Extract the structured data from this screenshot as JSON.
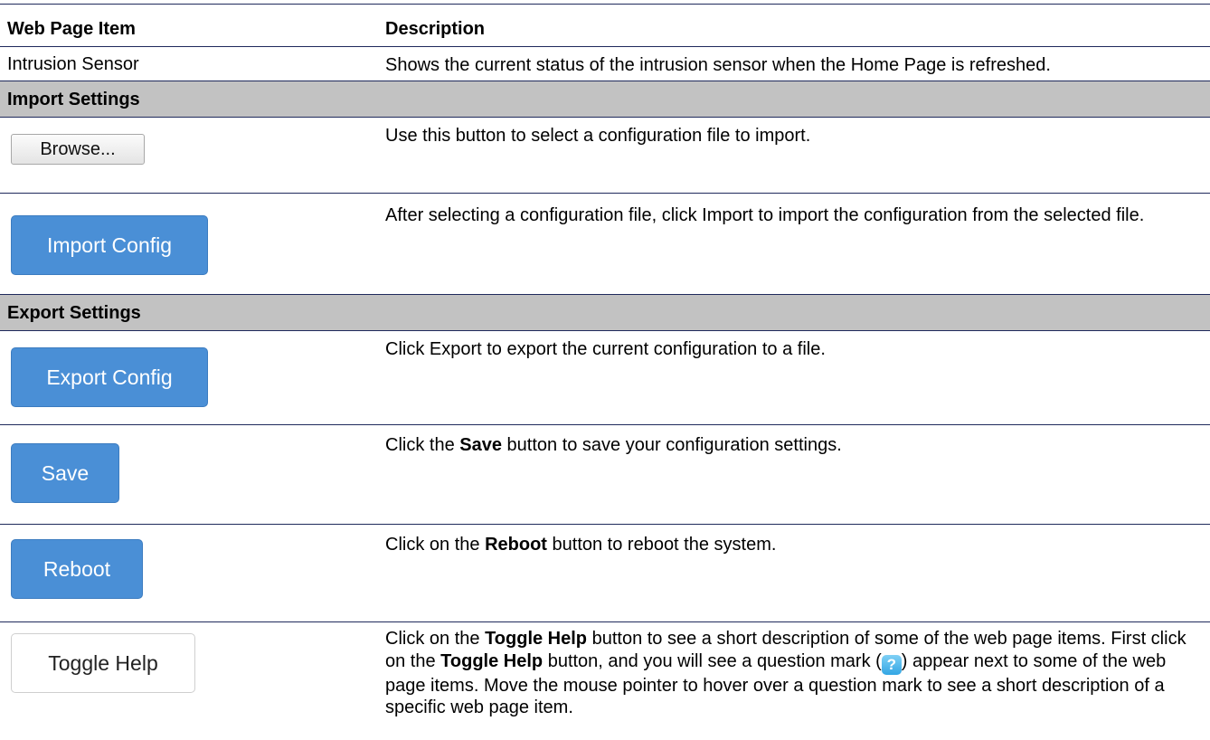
{
  "header": {
    "col_item": "Web Page Item",
    "col_description": "Description"
  },
  "rows": {
    "intrusion": {
      "item": "Intrusion Sensor",
      "description": "Shows the current status of the intrusion sensor when the Home Page is refreshed."
    },
    "import_section": "Import Settings",
    "browse": {
      "button": "Browse...",
      "description": "Use this button to select a configuration file to import."
    },
    "import_config": {
      "button": "Import Config",
      "description": "After selecting a configuration file, click Import to import the configuration from the selected file."
    },
    "export_section": "Export Settings",
    "export_config": {
      "button": "Export Config",
      "description": "Click Export to export the current configuration to a file."
    },
    "save": {
      "button": "Save",
      "desc_pre": "Click the ",
      "desc_bold": "Save",
      "desc_post": " button to save your configuration settings."
    },
    "reboot": {
      "button": "Reboot",
      "desc_pre": "Click on the ",
      "desc_bold": "Reboot",
      "desc_post": " button to reboot the system."
    },
    "toggle_help": {
      "button": "Toggle Help",
      "desc_1": "Click on the ",
      "desc_bold_1": "Toggle Help",
      "desc_2": " button to see a short description of some of the web page items. First click on the ",
      "desc_bold_2": "Toggle Help",
      "desc_3": " button, and you will see a question mark (",
      "qmark": "?",
      "desc_4": ") appear next to some of the web page items. Move the mouse pointer to hover over a question mark to see a short description of a specific web page item."
    }
  },
  "colors": {
    "blue_button": "#4a8fd6",
    "section_bg": "#c2c2c2",
    "rule": "#1f2a5c"
  }
}
